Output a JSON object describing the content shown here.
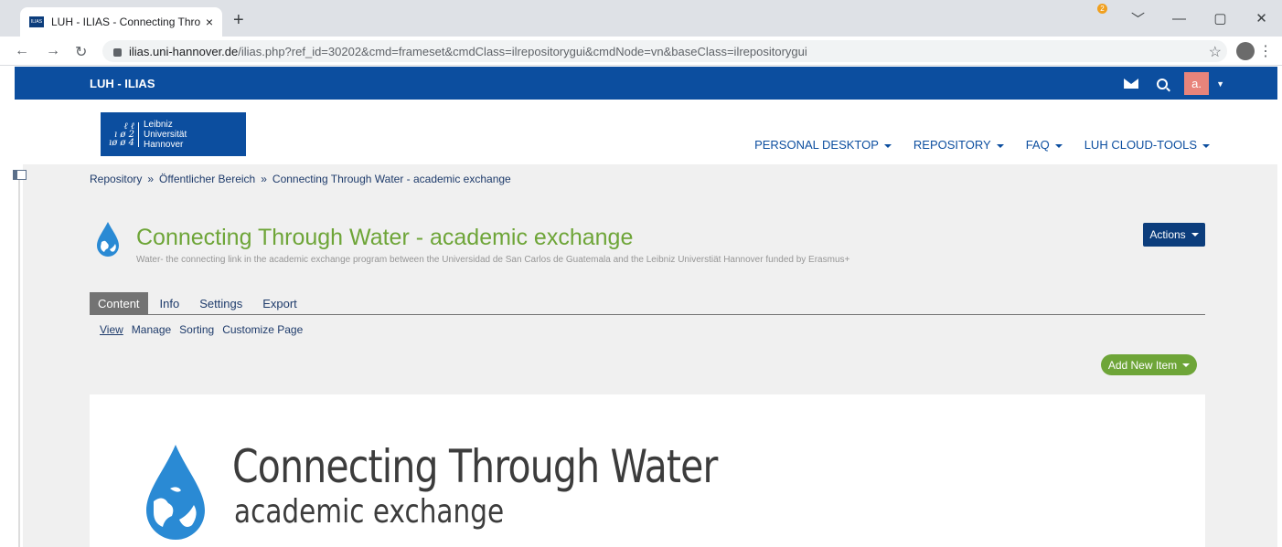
{
  "browser": {
    "tab_title": "LUH - ILIAS - Connecting Throug",
    "tab_favicon_text": "ILIAS",
    "tab_close": "×",
    "new_tab": "+",
    "url_host": "ilias.uni-hannover.de",
    "url_path": "/ilias.php?ref_id=30202&cmd=frameset&cmdClass=ilrepositorygui&cmdNode=vn&baseClass=ilrepositorygui",
    "window_controls": [
      "﹀",
      "—",
      "▢",
      "✕"
    ]
  },
  "topbar": {
    "brand": "LUH - ILIAS",
    "mail_count": "2",
    "avatar_letter": "a.",
    "bg_color": "#0c4e9f"
  },
  "logo": {
    "mark": "ℓ ℓ\nı ø 2\nıø ø 4",
    "lines": [
      "Leibniz",
      "Universität",
      "Hannover"
    ]
  },
  "mainnav": {
    "items": [
      {
        "label": "PERSONAL DESKTOP"
      },
      {
        "label": "REPOSITORY"
      },
      {
        "label": "FAQ"
      },
      {
        "label": "LUH CLOUD-TOOLS"
      }
    ]
  },
  "breadcrumb": {
    "items": [
      "Repository",
      "Öffentlicher Bereich",
      "Connecting Through Water - academic exchange"
    ],
    "separator": "»"
  },
  "page": {
    "title": "Connecting Through Water - academic exchange",
    "description": "Water- the connecting link in the academic exchange program between the Universidad de San Carlos de Guatemala and the Leibniz Universtiät Hannover funded by Erasmus+",
    "title_color": "#6ea538",
    "actions_label": "Actions"
  },
  "tabs": [
    {
      "label": "Content",
      "active": true
    },
    {
      "label": "Info",
      "active": false
    },
    {
      "label": "Settings",
      "active": false
    },
    {
      "label": "Export",
      "active": false
    }
  ],
  "subtabs": [
    {
      "label": "View",
      "active": true
    },
    {
      "label": "Manage",
      "active": false
    },
    {
      "label": "Sorting",
      "active": false
    },
    {
      "label": "Customize Page",
      "active": false
    }
  ],
  "add_new_label": "Add New Item",
  "banner": {
    "title": "Connecting Through Water",
    "subtitle": "academic exchange",
    "accent_color": "#2a8ad4"
  }
}
